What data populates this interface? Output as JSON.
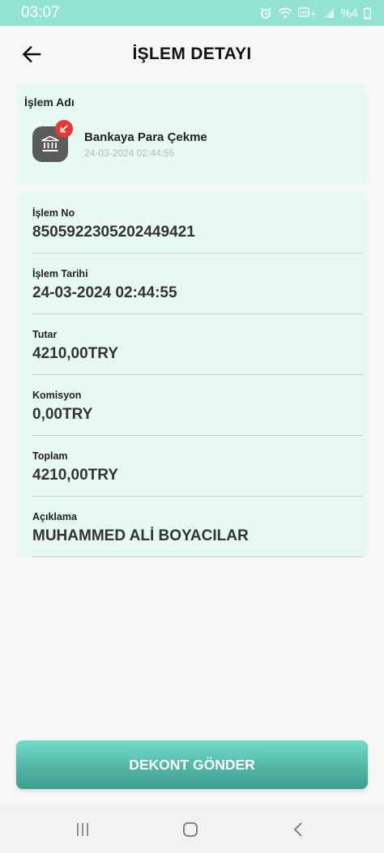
{
  "status_bar": {
    "time": "03:07",
    "battery_text": "%4",
    "icons": [
      "alarm-icon",
      "wifi-icon",
      "volte-icon",
      "signal-icon",
      "battery-icon"
    ]
  },
  "header": {
    "title": "İŞLEM DETAYI",
    "back_icon": "arrow-left-icon"
  },
  "transaction_card": {
    "label": "İşlem Adı",
    "icon": "bank-icon",
    "badge_icon": "arrow-down-left-icon",
    "title": "Bankaya Para Çekme",
    "date": "24-03-2024 02:44:55"
  },
  "details": {
    "transaction_no": {
      "label": "İşlem No",
      "value": "8505922305202449421"
    },
    "transaction_date": {
      "label": "İşlem Tarihi",
      "value": "24-03-2024 02:44:55"
    },
    "amount": {
      "label": "Tutar",
      "value": "4210,00TRY"
    },
    "commission": {
      "label": "Komisyon",
      "value": "0,00TRY"
    },
    "total": {
      "label": "Toplam",
      "value": "4210,00TRY"
    },
    "description": {
      "label": "Açıklama",
      "value": "MUHAMMED ALİ BOYACILAR"
    }
  },
  "actions": {
    "send_receipt_label": "DEKONT GÖNDER"
  },
  "colors": {
    "accent": "#4fb2a3",
    "status_bar": "#93e3d3",
    "card_background": "#e8f8f5",
    "badge_red": "#e53935"
  }
}
